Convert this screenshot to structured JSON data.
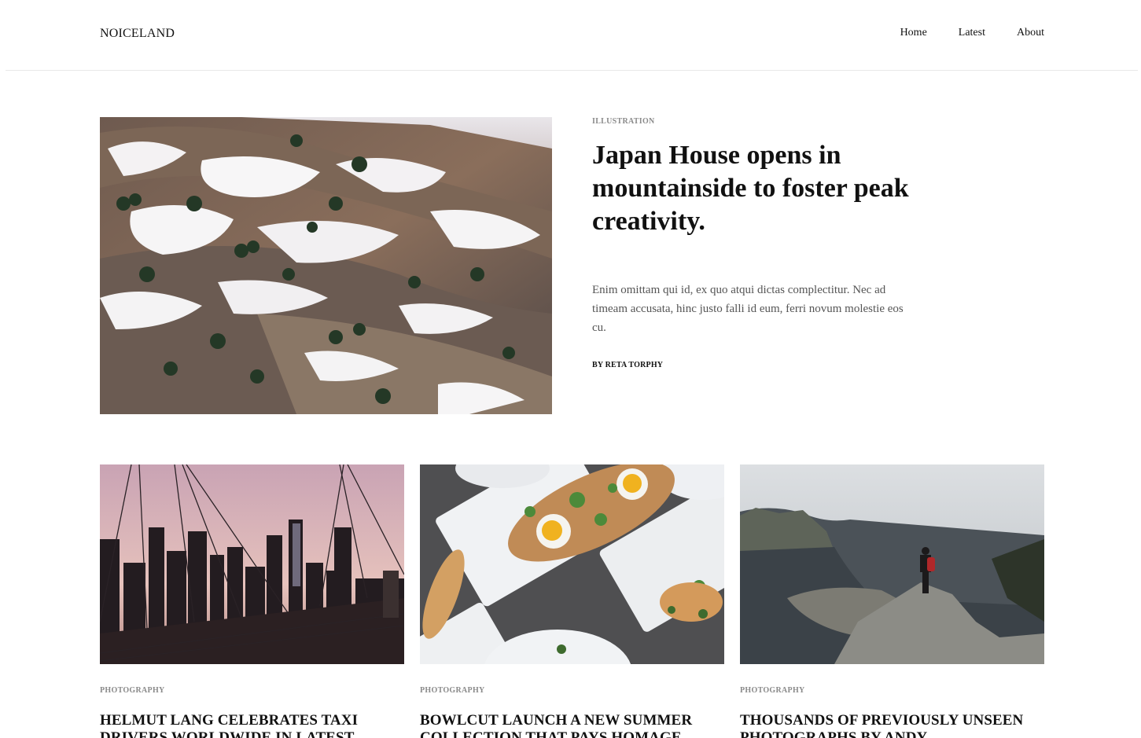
{
  "header": {
    "logo": "NOICELAND",
    "nav": [
      "Home",
      "Latest",
      "About"
    ]
  },
  "featured": {
    "category": "ILLUSTRATION",
    "title": "Japan House opens in mountainside to foster peak creativity.",
    "excerpt": "Enim omittam qui id, ex quo atqui dictas complectitur. Nec ad timeam accusata, hinc justo falli id eum, ferri novum molestie eos cu.",
    "byline": "BY RETA TORPHY",
    "image": "snowy-mountain-photo"
  },
  "cards": [
    {
      "category": "PHOTOGRAPHY",
      "title": "HELMUT LANG CELEBRATES TAXI DRIVERS WORLDWIDE IN LATEST",
      "image": "bridge-city-skyline-photo"
    },
    {
      "category": "PHOTOGRAPHY",
      "title": "BOWLCUT LAUNCH A NEW SUMMER COLLECTION THAT PAYS HOMAGE",
      "image": "plated-food-photo"
    },
    {
      "category": "PHOTOGRAPHY",
      "title": "THOUSANDS OF PREVIOUSLY UNSEEN PHOTOGRAPHS BY ANDY",
      "image": "hiker-coastline-photo"
    }
  ]
}
